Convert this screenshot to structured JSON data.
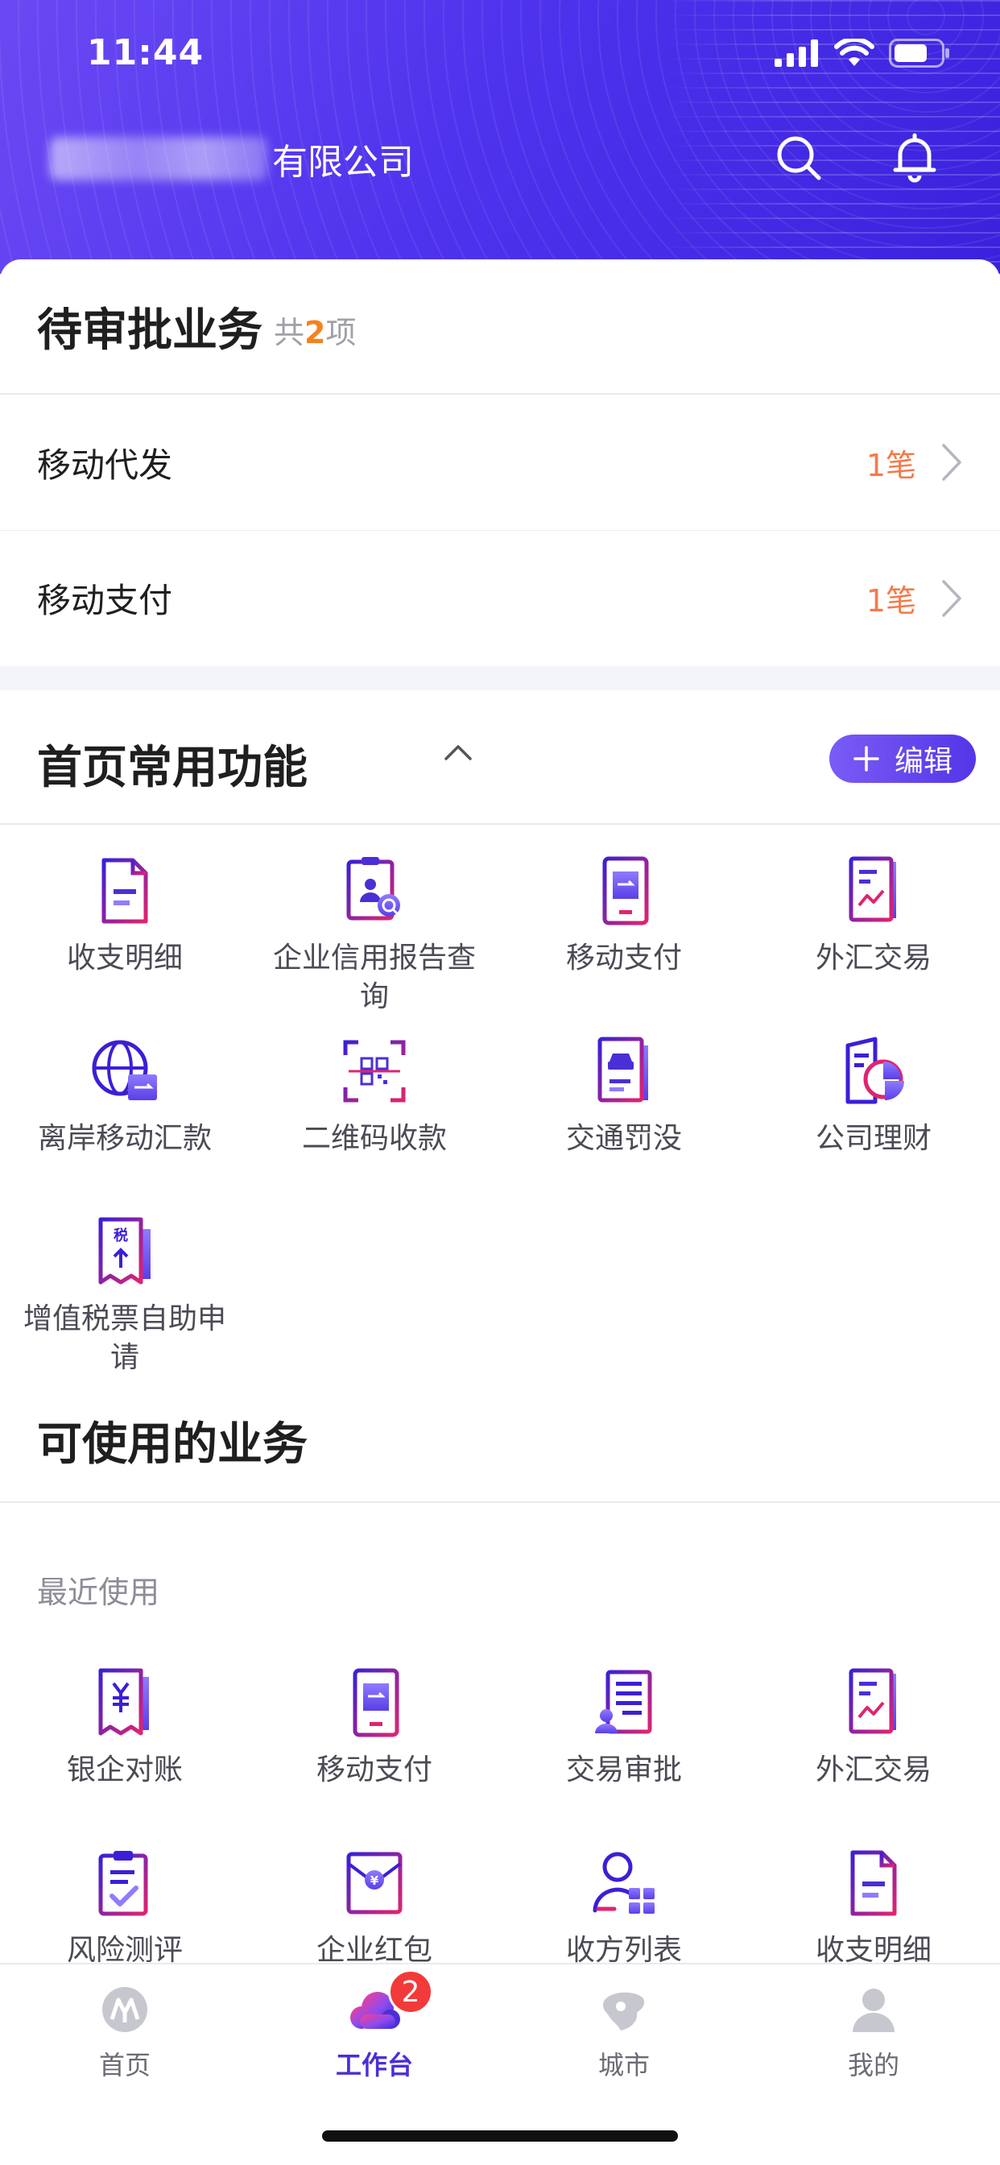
{
  "status": {
    "time": "11:44"
  },
  "header": {
    "company_suffix": "有限公司"
  },
  "pending": {
    "title": "待审批业务",
    "count_prefix": "共",
    "count_value": "2",
    "count_suffix": "项",
    "items": [
      {
        "label": "移动代发",
        "qty": "1笔"
      },
      {
        "label": "移动支付",
        "qty": "1笔"
      }
    ]
  },
  "favorites": {
    "title": "首页常用功能",
    "edit_label": "编辑",
    "items": [
      {
        "label": "收支明细",
        "icon": "document-icon"
      },
      {
        "label": "企业信用报告查询",
        "icon": "credit-report-search-icon"
      },
      {
        "label": "移动支付",
        "icon": "mobile-pay-icon"
      },
      {
        "label": "外汇交易",
        "icon": "forex-chart-icon"
      },
      {
        "label": "离岸移动汇款",
        "icon": "globe-transfer-icon"
      },
      {
        "label": "二维码收款",
        "icon": "qr-code-icon"
      },
      {
        "label": "交通罚没",
        "icon": "traffic-fine-icon"
      },
      {
        "label": "公司理财",
        "icon": "wealth-pie-icon"
      },
      {
        "label": "增值税票自助申请",
        "icon": "tax-invoice-icon"
      }
    ]
  },
  "available": {
    "title": "可使用的业务",
    "recent_label": "最近使用",
    "items": [
      {
        "label": "银企对账",
        "icon": "yuan-receipt-icon"
      },
      {
        "label": "移动支付",
        "icon": "mobile-pay-icon"
      },
      {
        "label": "交易审批",
        "icon": "approval-list-icon"
      },
      {
        "label": "外汇交易",
        "icon": "forex-chart-icon"
      },
      {
        "label": "风险测评",
        "icon": "clipboard-check-icon"
      },
      {
        "label": "企业红包",
        "icon": "red-packet-icon"
      },
      {
        "label": "收方列表",
        "icon": "payee-list-icon"
      },
      {
        "label": "收支明细",
        "icon": "document-icon"
      }
    ]
  },
  "tabbar": {
    "tabs": [
      {
        "label": "首页",
        "icon": "bank-logo-icon"
      },
      {
        "label": "工作台",
        "icon": "cloud-workbench-icon"
      },
      {
        "label": "城市",
        "icon": "city-icon"
      },
      {
        "label": "我的",
        "icon": "profile-icon"
      }
    ],
    "badge": "2"
  },
  "colors": {
    "primary": "#4f34ee",
    "accent_orange": "#f5821f",
    "qty_orange": "#f47a4b",
    "badge_red": "#f23a3a"
  }
}
